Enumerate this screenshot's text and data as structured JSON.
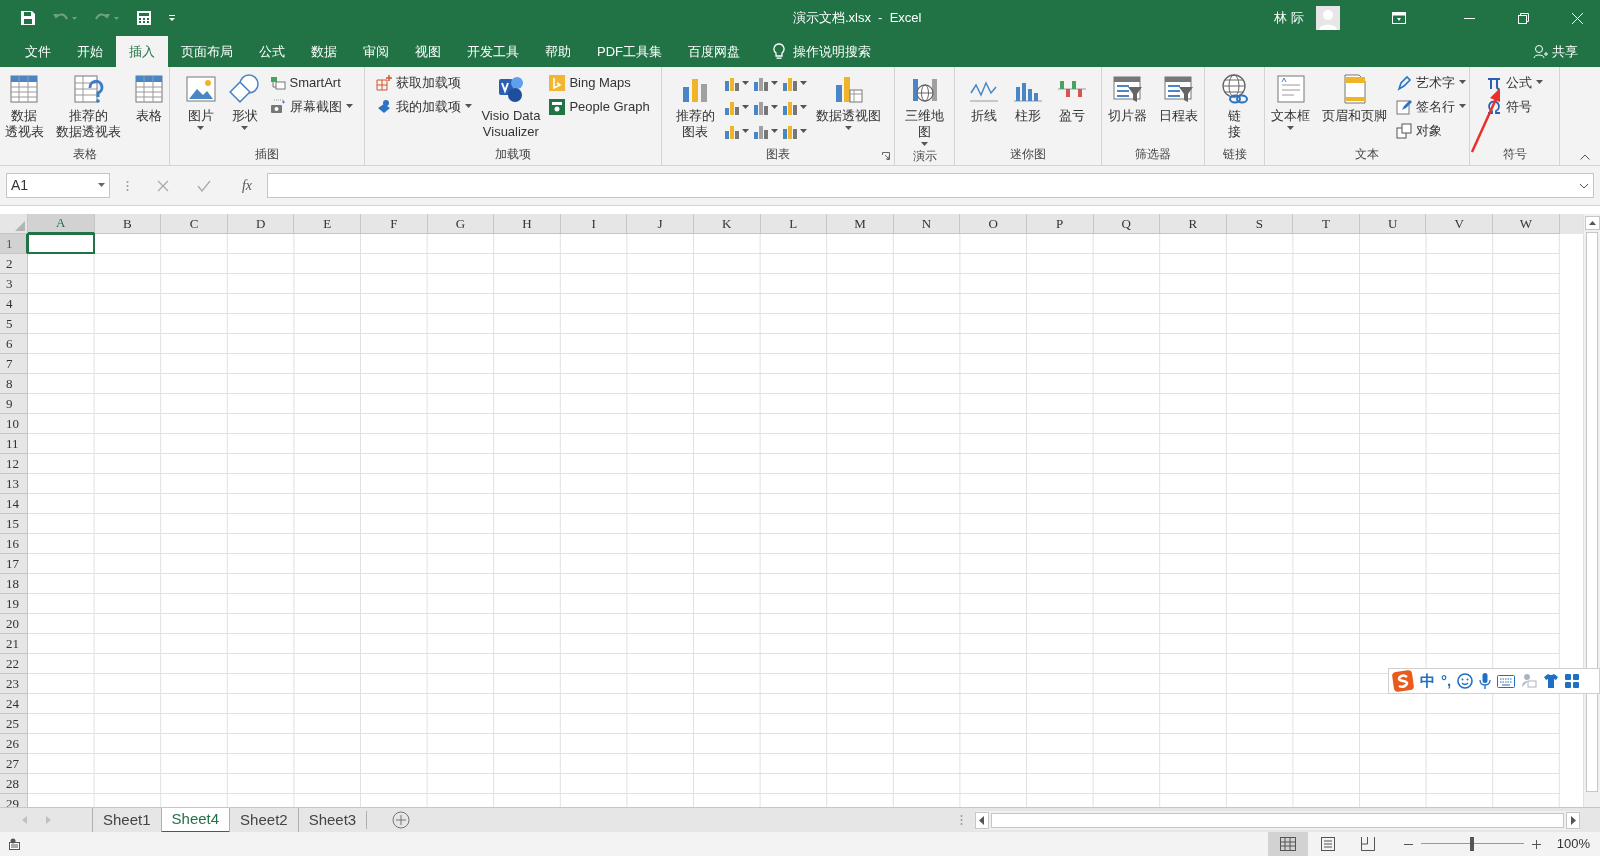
{
  "title_bar": {
    "title": "演示文档.xlsx  -  Excel",
    "user": "林 际"
  },
  "tabs": [
    {
      "label": "文件",
      "selected": false
    },
    {
      "label": "开始",
      "selected": false
    },
    {
      "label": "插入",
      "selected": true
    },
    {
      "label": "页面布局",
      "selected": false
    },
    {
      "label": "公式",
      "selected": false
    },
    {
      "label": "数据",
      "selected": false
    },
    {
      "label": "审阅",
      "selected": false
    },
    {
      "label": "视图",
      "selected": false
    },
    {
      "label": "开发工具",
      "selected": false
    },
    {
      "label": "帮助",
      "selected": false
    },
    {
      "label": "PDF工具集",
      "selected": false
    },
    {
      "label": "百度网盘",
      "selected": false
    }
  ],
  "tell_me": "操作说明搜索",
  "share": "共享",
  "ribbon_groups": [
    {
      "label": "表格",
      "items": [
        {
          "kind": "large",
          "lines": [
            "数据",
            "透视表"
          ],
          "dropdown": false
        },
        {
          "kind": "large",
          "lines": [
            "推荐的",
            "数据透视表"
          ],
          "dropdown": false
        },
        {
          "kind": "large",
          "lines": [
            "表格"
          ],
          "dropdown": false
        }
      ]
    },
    {
      "label": "插图",
      "items": [
        {
          "kind": "large",
          "lines": [
            "图片"
          ],
          "dropdown": true
        },
        {
          "kind": "large",
          "lines": [
            "形状"
          ],
          "dropdown": true
        },
        {
          "kind": "stack",
          "items": [
            {
              "label": "SmartArt",
              "dropdown": false
            },
            {
              "label": "屏幕截图",
              "dropdown": true
            }
          ]
        }
      ]
    },
    {
      "label": "加载项",
      "items": [
        {
          "kind": "stack",
          "items": [
            {
              "label": "获取加载项",
              "dropdown": false
            },
            {
              "label": "我的加载项",
              "dropdown": true
            }
          ]
        },
        {
          "kind": "large",
          "lines": [
            "Visio Data",
            "Visualizer"
          ],
          "dropdown": false
        },
        {
          "kind": "stack",
          "items": [
            {
              "label": "Bing Maps",
              "dropdown": false
            },
            {
              "label": "People Graph",
              "dropdown": false
            }
          ]
        }
      ]
    },
    {
      "label": "图表",
      "launcher": true,
      "items": [
        {
          "kind": "large",
          "lines": [
            "推荐的",
            "图表"
          ],
          "dropdown": false
        },
        {
          "kind": "icon_grid"
        },
        {
          "kind": "large",
          "lines": [
            "数据透视图"
          ],
          "dropdown": true
        }
      ]
    },
    {
      "label": "演示",
      "items": [
        {
          "kind": "large",
          "lines": [
            "三维地",
            "图"
          ],
          "dropdown": true
        }
      ]
    },
    {
      "label": "迷你图",
      "items": [
        {
          "kind": "large",
          "lines": [
            "折线"
          ],
          "dropdown": false
        },
        {
          "kind": "large",
          "lines": [
            "柱形"
          ],
          "dropdown": false
        },
        {
          "kind": "large",
          "lines": [
            "盈亏"
          ],
          "dropdown": false
        }
      ]
    },
    {
      "label": "筛选器",
      "items": [
        {
          "kind": "large",
          "lines": [
            "切片器"
          ],
          "dropdown": false
        },
        {
          "kind": "large",
          "lines": [
            "日程表"
          ],
          "dropdown": false
        }
      ]
    },
    {
      "label": "链接",
      "items": [
        {
          "kind": "large",
          "lines": [
            "链",
            "接"
          ],
          "dropdown": false
        }
      ]
    },
    {
      "label": "文本",
      "items": [
        {
          "kind": "large",
          "lines": [
            "文本框"
          ],
          "dropdown": true
        },
        {
          "kind": "large",
          "lines": [
            "页眉和页脚"
          ],
          "dropdown": false
        },
        {
          "kind": "stack",
          "items": [
            {
              "label": "艺术字",
              "dropdown": true
            },
            {
              "label": "签名行",
              "dropdown": true
            },
            {
              "label": "对象",
              "dropdown": false
            }
          ]
        }
      ]
    },
    {
      "label": "符号",
      "items": [
        {
          "kind": "stack",
          "items": [
            {
              "label": "公式",
              "dropdown": true
            },
            {
              "label": "符号",
              "dropdown": false
            }
          ]
        }
      ]
    }
  ],
  "formula_bar": {
    "name_box": "A1",
    "function_label": "fx"
  },
  "columns": [
    {
      "label": "A",
      "selected": true
    },
    {
      "label": "B",
      "selected": false
    },
    {
      "label": "C",
      "selected": false
    },
    {
      "label": "D",
      "selected": false
    },
    {
      "label": "E",
      "selected": false
    },
    {
      "label": "F",
      "selected": false
    },
    {
      "label": "G",
      "selected": false
    },
    {
      "label": "H",
      "selected": false
    },
    {
      "label": "I",
      "selected": false
    },
    {
      "label": "J",
      "selected": false
    },
    {
      "label": "K",
      "selected": false
    },
    {
      "label": "L",
      "selected": false
    },
    {
      "label": "M",
      "selected": false
    },
    {
      "label": "N",
      "selected": false
    },
    {
      "label": "O",
      "selected": false
    },
    {
      "label": "P",
      "selected": false
    },
    {
      "label": "Q",
      "selected": false
    },
    {
      "label": "R",
      "selected": false
    },
    {
      "label": "S",
      "selected": false
    },
    {
      "label": "T",
      "selected": false
    },
    {
      "label": "U",
      "selected": false
    },
    {
      "label": "V",
      "selected": false
    },
    {
      "label": "W",
      "selected": false
    }
  ],
  "rows": [
    {
      "label": "1",
      "selected": true
    },
    {
      "label": "2",
      "selected": false
    },
    {
      "label": "3",
      "selected": false
    },
    {
      "label": "4",
      "selected": false
    },
    {
      "label": "5",
      "selected": false
    },
    {
      "label": "6",
      "selected": false
    },
    {
      "label": "7",
      "selected": false
    },
    {
      "label": "8",
      "selected": false
    },
    {
      "label": "9",
      "selected": false
    },
    {
      "label": "10",
      "selected": false
    },
    {
      "label": "11",
      "selected": false
    },
    {
      "label": "12",
      "selected": false
    },
    {
      "label": "13",
      "selected": false
    },
    {
      "label": "14",
      "selected": false
    },
    {
      "label": "15",
      "selected": false
    },
    {
      "label": "16",
      "selected": false
    },
    {
      "label": "17",
      "selected": false
    },
    {
      "label": "18",
      "selected": false
    },
    {
      "label": "19",
      "selected": false
    },
    {
      "label": "20",
      "selected": false
    },
    {
      "label": "21",
      "selected": false
    },
    {
      "label": "22",
      "selected": false
    },
    {
      "label": "23",
      "selected": false
    },
    {
      "label": "24",
      "selected": false
    },
    {
      "label": "25",
      "selected": false
    },
    {
      "label": "26",
      "selected": false
    },
    {
      "label": "27",
      "selected": false
    },
    {
      "label": "28",
      "selected": false
    },
    {
      "label": "29",
      "selected": false
    }
  ],
  "sheets": [
    {
      "label": "Sheet1",
      "selected": false
    },
    {
      "label": "Sheet4",
      "selected": true
    },
    {
      "label": "Sheet2",
      "selected": false
    },
    {
      "label": "Sheet3",
      "selected": false
    }
  ],
  "status_bar": {
    "views": [
      {
        "kind": "normal",
        "selected": true
      },
      {
        "kind": "page_layout",
        "selected": false
      },
      {
        "kind": "page_break",
        "selected": false
      }
    ],
    "zoom": {
      "level": 0.5,
      "reading": "100%"
    }
  },
  "ime_toolbar": {
    "texts": [
      "中",
      "°,"
    ]
  }
}
